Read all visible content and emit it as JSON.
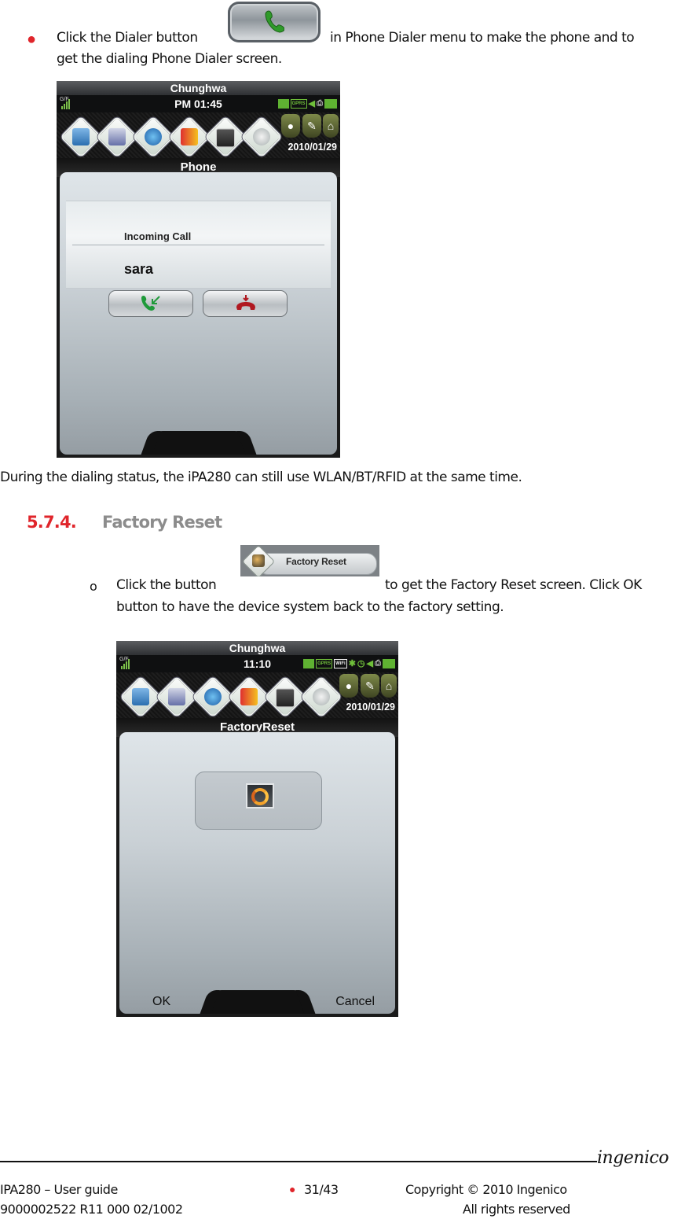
{
  "section1": {
    "bullet_line1_before": "Click the Dialer button",
    "bullet_line1_after": "in Phone Dialer menu to make the phone and to",
    "bullet_line2": "get the dialing Phone Dialer screen.",
    "dialer_button_icon": "phone-handset-icon"
  },
  "phone_screen_1": {
    "carrier": "Chunghwa",
    "time": "PM 01:45",
    "signal_label": "G/F",
    "date": "2010/01/29",
    "title": "Phone",
    "call_label": "Incoming Call",
    "caller_name": "sara",
    "toolbar_icons": [
      "phone-icon",
      "keyboard-icon",
      "globe-icon",
      "lock-icon",
      "monitor-check-icon",
      "magnifier-icon"
    ],
    "quick_buttons": [
      "contact-icon",
      "wrench-icon",
      "home-icon"
    ],
    "status_icons": [
      "usb-icon",
      "gprs-icon",
      "speaker-icon",
      "printer-icon",
      "battery-icon"
    ],
    "gprs_label": "GPRS",
    "accept_icon": "answer-call-icon",
    "reject_icon": "hangup-call-icon"
  },
  "body_text": "During the dialing status, the iPA280 can still use WLAN/BT/RFID at the same time.",
  "heading": {
    "number": "5.7.4.",
    "title": "Factory Reset"
  },
  "section2": {
    "line1_before": "Click the button",
    "line1_after": "to get the Factory Reset screen. Click OK",
    "line2": "button to have the device system back to the factory setting.",
    "inline_button_label": "Factory Reset",
    "bullet": "o"
  },
  "phone_screen_2": {
    "carrier": "Chunghwa",
    "time": "11:10",
    "signal_label": "G/F",
    "date": "2010/01/29",
    "title": "FactoryReset",
    "gprs_label": "GPRS",
    "wifi_label": "WiFi",
    "ok_label": "OK",
    "cancel_label": "Cancel",
    "center_icon": "factory-reset-icon"
  },
  "footer": {
    "logo": "ingenico",
    "doc_title": "IPA280 – User guide",
    "doc_ref": "9000002522 R11 000 02/1002",
    "page": "31/43",
    "copyright": "Copyright © 2010 Ingenico",
    "rights": "All rights reserved"
  }
}
